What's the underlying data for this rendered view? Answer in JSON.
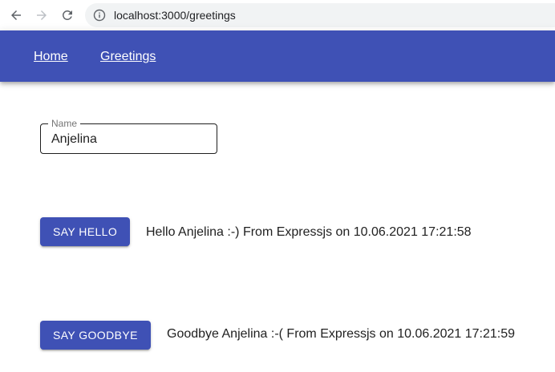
{
  "browser": {
    "url": "localhost:3000/greetings",
    "icons": [
      "back-arrow-icon",
      "forward-arrow-icon",
      "reload-icon",
      "info-icon"
    ]
  },
  "nav": {
    "links": [
      {
        "label": "Home"
      },
      {
        "label": "Greetings"
      }
    ],
    "color": "#3f51b5"
  },
  "form": {
    "name_label": "Name",
    "name_value": "Anjelina"
  },
  "hello": {
    "button_label": "Say Hello",
    "message": "Hello Anjelina :-) From Expressjs on 10.06.2021 17:21:58"
  },
  "goodbye": {
    "button_label": "Say Goodbye",
    "message": "Goodbye Anjelina :-( From Expressjs on 10.06.2021 17:21:59"
  },
  "colors": {
    "primary": "#3f51b5",
    "text": "#212121"
  }
}
